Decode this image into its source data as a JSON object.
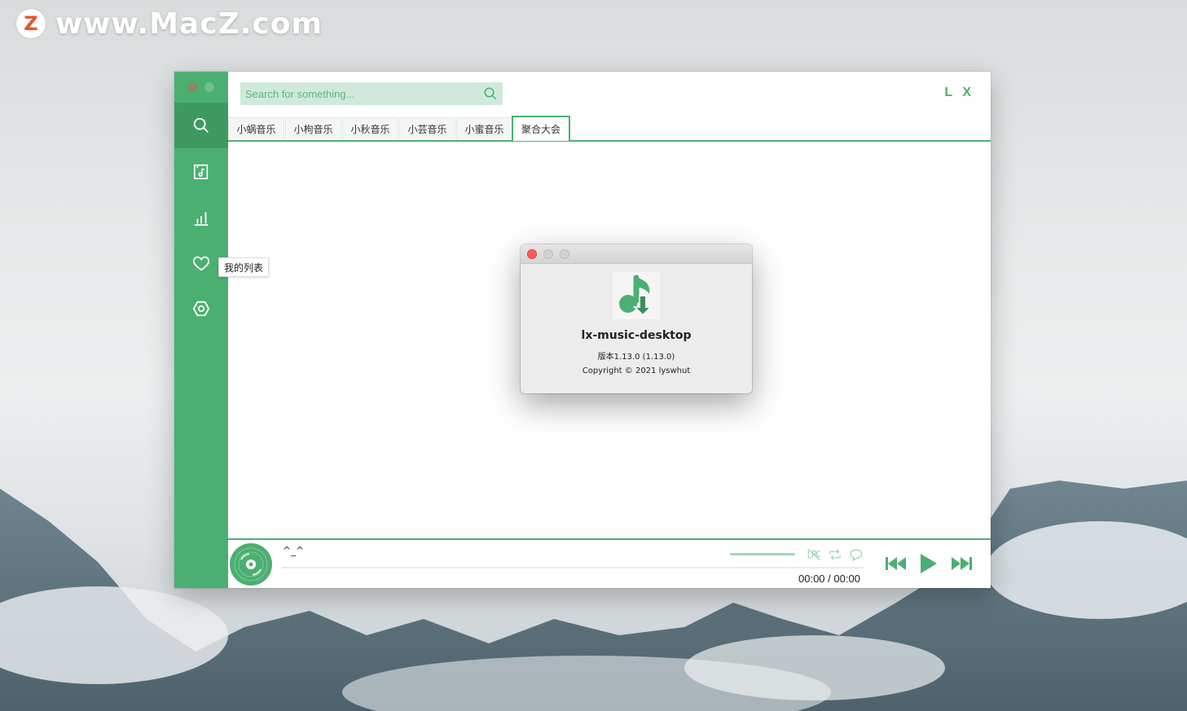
{
  "watermark": {
    "badge": "Z",
    "text": "www.MacZ.com"
  },
  "app": {
    "brand": "L X",
    "search": {
      "placeholder": "Search for something...",
      "value": ""
    },
    "sidebar": {
      "items": [
        {
          "icon": "search-icon"
        },
        {
          "icon": "music-file-icon"
        },
        {
          "icon": "chart-icon"
        },
        {
          "icon": "heart-icon",
          "tooltip": "我的列表"
        },
        {
          "icon": "settings-icon"
        }
      ]
    },
    "tabs": [
      {
        "label": "小蜗音乐"
      },
      {
        "label": "小枸音乐"
      },
      {
        "label": "小秋音乐"
      },
      {
        "label": "小芸音乐"
      },
      {
        "label": "小蜜音乐"
      },
      {
        "label": "聚合大会",
        "active": true
      }
    ],
    "player": {
      "song": "^_^",
      "current_time": "00:00",
      "separator": "/",
      "total_time": "00:00",
      "icons": [
        "lrc-icon",
        "repeat-icon",
        "comment-icon",
        "previous-icon",
        "play-icon",
        "next-icon"
      ]
    },
    "accent": "#4caf72"
  },
  "about": {
    "name": "lx-music-desktop",
    "version": "版本1.13.0 (1.13.0)",
    "copyright": "Copyright © 2021 lyswhut"
  }
}
